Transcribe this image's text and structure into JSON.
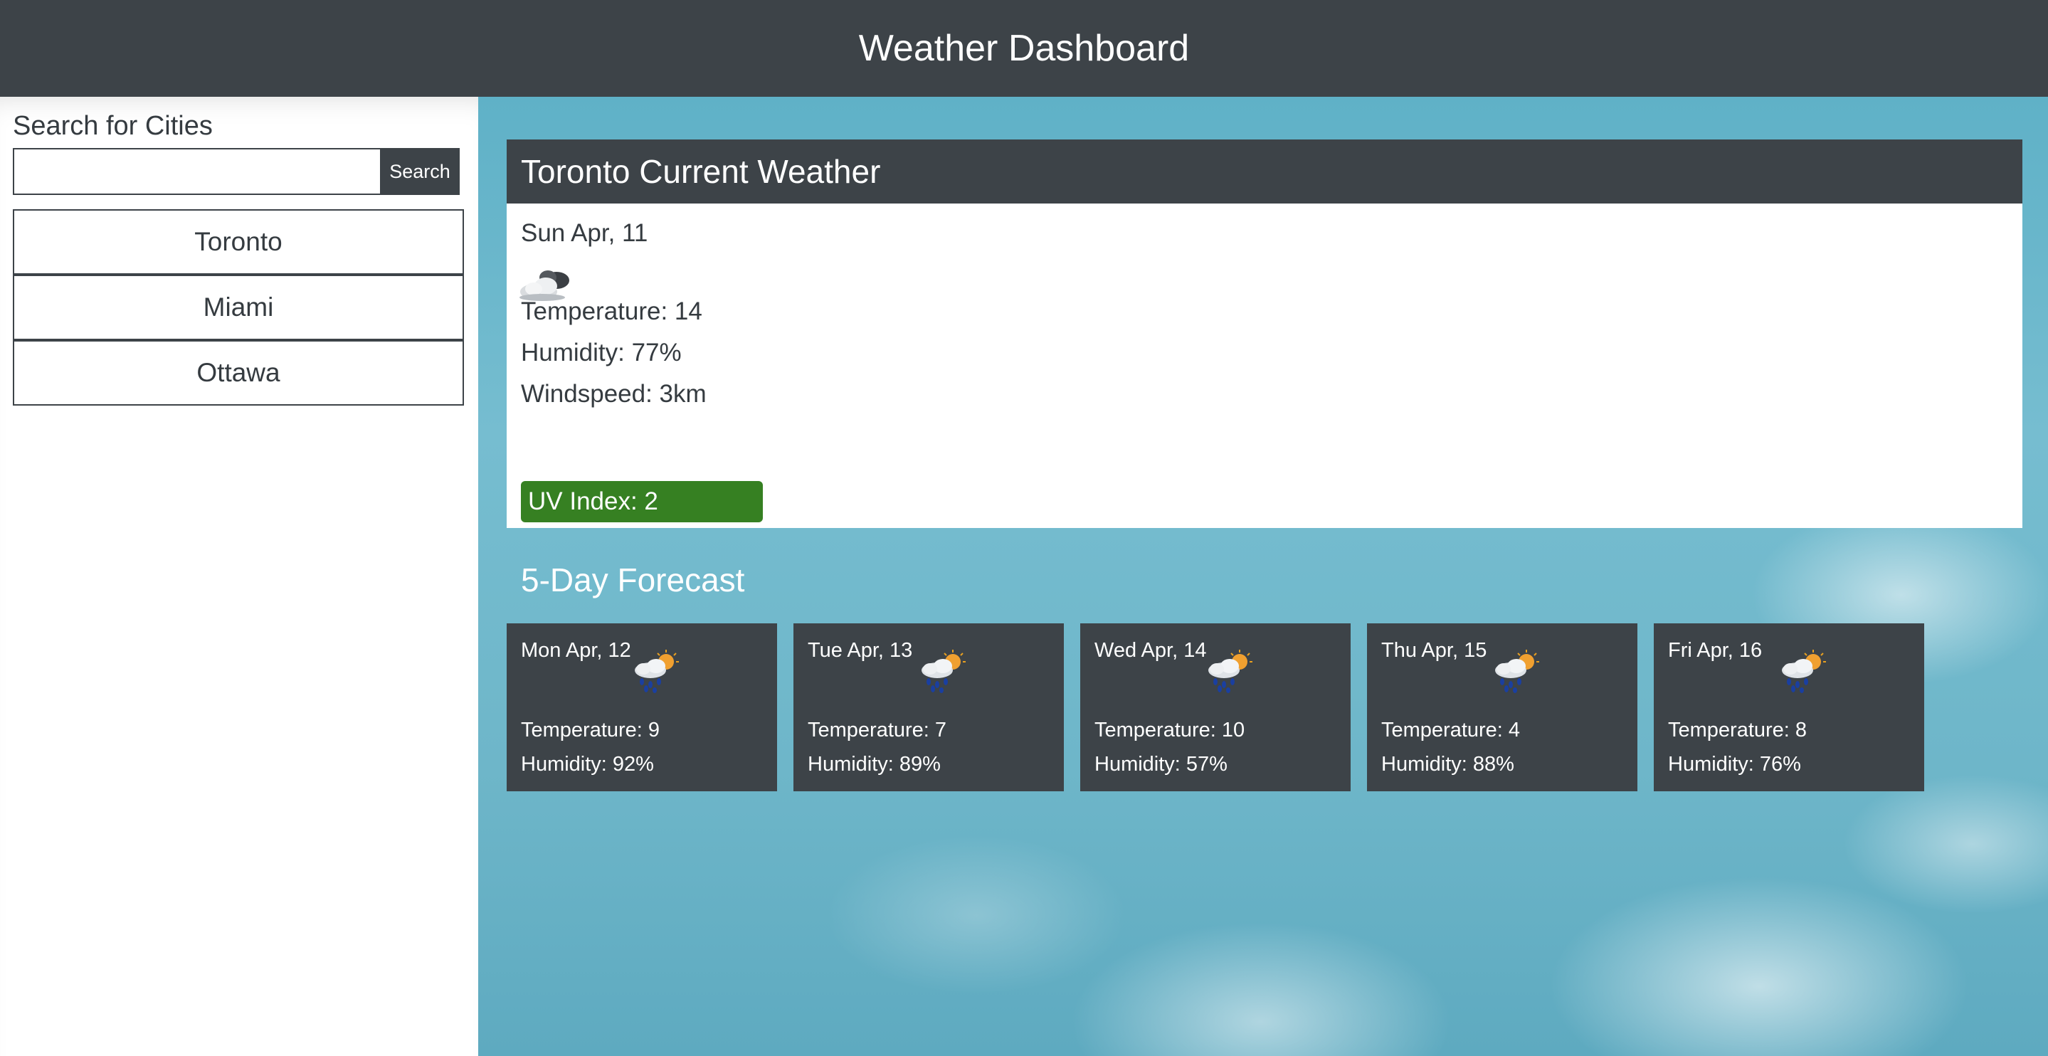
{
  "header": {
    "title": "Weather Dashboard"
  },
  "sidebar": {
    "heading": "Search for Cities",
    "search_value": "",
    "search_placeholder": "",
    "search_button": "Search",
    "cities": [
      "Toronto",
      "Miami",
      "Ottawa"
    ]
  },
  "current": {
    "title": "Toronto Current Weather",
    "date": "Sun Apr, 11",
    "icon": "broken-clouds-icon",
    "temperature": "Temperature: 14",
    "humidity": "Humidity: 77%",
    "windspeed": "Windspeed: 3km",
    "uv": "UV Index: 2",
    "uv_color": "#368022"
  },
  "forecast": {
    "heading": "5-Day Forecast",
    "days": [
      {
        "date": "Mon Apr, 12",
        "icon": "rain-sun-icon",
        "temperature": "Temperature: 9",
        "humidity": "Humidity: 92%"
      },
      {
        "date": "Tue Apr, 13",
        "icon": "rain-sun-icon",
        "temperature": "Temperature: 7",
        "humidity": "Humidity: 89%"
      },
      {
        "date": "Wed Apr, 14",
        "icon": "rain-sun-icon",
        "temperature": "Temperature: 10",
        "humidity": "Humidity: 57%"
      },
      {
        "date": "Thu Apr, 15",
        "icon": "rain-sun-icon",
        "temperature": "Temperature: 4",
        "humidity": "Humidity: 88%"
      },
      {
        "date": "Fri Apr, 16",
        "icon": "rain-sun-icon",
        "temperature": "Temperature: 8",
        "humidity": "Humidity: 76%"
      }
    ]
  },
  "colors": {
    "header_bg": "#3d4348",
    "card_bg": "#3d4348",
    "sky": "#76bdd0"
  }
}
